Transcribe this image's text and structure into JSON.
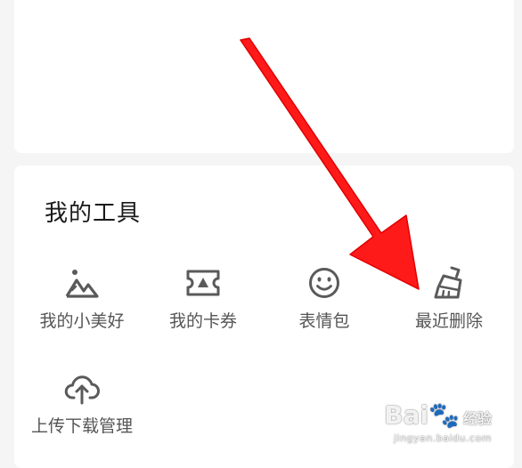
{
  "section": {
    "title": "我的工具"
  },
  "tools": [
    {
      "label": "我的小美好",
      "icon": "mountain-photo-icon"
    },
    {
      "label": "我的卡券",
      "icon": "ticket-coupon-icon"
    },
    {
      "label": "表情包",
      "icon": "smiley-face-icon"
    },
    {
      "label": "最近删除",
      "icon": "broom-clean-icon"
    },
    {
      "label": "上传下载管理",
      "icon": "cloud-upload-icon"
    }
  ],
  "watermark": {
    "logo": "Bai",
    "logo_tail": "经验",
    "url": "jingyan.baidu.com"
  },
  "colors": {
    "background": "#f5f5f5",
    "card": "#ffffff",
    "icon": "#5a5a5a",
    "label": "#555555",
    "title": "#1a1a1a",
    "arrow": "#ff1a1a"
  }
}
